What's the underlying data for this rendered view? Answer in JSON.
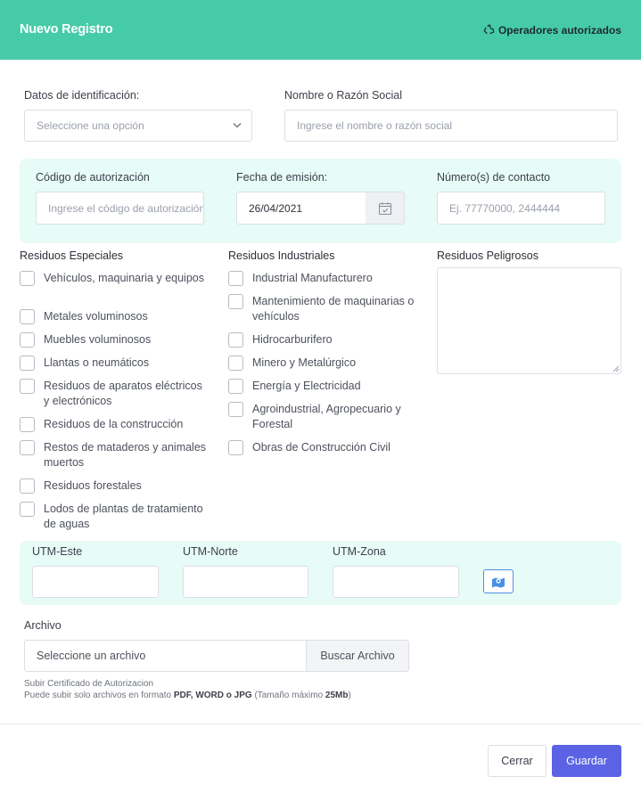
{
  "header": {
    "title": "Nuevo Registro",
    "link_label": "Operadores autorizados",
    "link_icon": "recycle-icon"
  },
  "identificacion": {
    "datos_label": "Datos de identificación:",
    "datos_placeholder": "Seleccione una opción",
    "nombre_label": "Nombre o Razón Social",
    "nombre_placeholder": "Ingrese el nombre o razón social"
  },
  "autorizacion": {
    "codigo_label": "Código de autorización",
    "codigo_placeholder": "Ingrese el código de autorización",
    "fecha_label": "Fecha de emisión:",
    "fecha_value": "26/04/2021",
    "contacto_label": "Númerο(s) de contacto",
    "contacto_placeholder": "Ej. 77770000, 2444444"
  },
  "residuos_especiales": {
    "title": "Residuos Especiales",
    "items": [
      "Vehículos, maquinaria y equipos",
      "Metales voluminosos",
      "Muebles voluminosos",
      "Llantas o neumáticos",
      "Residuos de aparatos eléctricos y electrónicos",
      "Residuos de la construcción",
      "Restos de mataderos y animales muertos",
      "Residuos forestales",
      "Lodos de plantas de tratamiento de aguas"
    ]
  },
  "residuos_industriales": {
    "title": "Residuos Industriales",
    "items": [
      "Industrial Manufacturero",
      "Mantenimiento de maquinarias o vehículos",
      "Hidrocarburifero",
      "Minero y Metalúrgico",
      "Energía y Electricidad",
      "Agroindustrial, Agropecuario y Forestal",
      "Obras de Construcción Civil"
    ]
  },
  "residuos_peligrosos": {
    "title": "Residuos Peligrosos"
  },
  "utm": {
    "este_label": "UTM-Este",
    "norte_label": "UTM-Norte",
    "zona_label": "UTM-Zona",
    "map_icon": "map-marker-icon"
  },
  "archivo": {
    "label": "Archivo",
    "placeholder": "Seleccione un archivo",
    "button": "Buscar Archivo",
    "hint1": "Subir Certificado de Autorizacion",
    "hint2_pre": "Puede subir solo archivos en formato ",
    "hint2_formats": "PDF, WORD o JPG",
    "hint2_mid": " (Tamaño máximo ",
    "hint2_size": "25Mb",
    "hint2_post": ")"
  },
  "footer": {
    "close": "Cerrar",
    "save": "Guardar"
  },
  "colors": {
    "header": "#46cba9",
    "panel": "#e7fbf7",
    "primary": "#5b63e4",
    "map_button": "#4a90e2"
  }
}
